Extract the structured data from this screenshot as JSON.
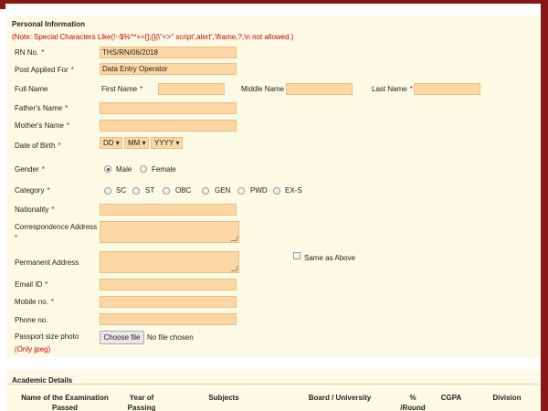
{
  "personal": {
    "title": "Personal Information",
    "note": "(Note: Special Characters Like(!~$%^*+=[];{}|\\\"<>\" script',alert','iframe,?,\\n not allowed.)",
    "rn_no": {
      "label": "RN No.",
      "value": "THS/RN/06/2018"
    },
    "post_applied": {
      "label": "Post Applied For",
      "value": "Data Entry Operator"
    },
    "full_name": {
      "label": "Full Name",
      "first_label": "First Name",
      "middle_label": "Middle Name",
      "last_label": "Last Name",
      "first": "",
      "middle": "",
      "last": ""
    },
    "father": {
      "label": "Father's Name",
      "value": ""
    },
    "mother": {
      "label": "Mother's Name",
      "value": ""
    },
    "dob": {
      "label": "Date of Birth",
      "dd": "DD",
      "mm": "MM",
      "yyyy": "YYYY"
    },
    "gender": {
      "label": "Gender",
      "options": [
        "Male",
        "Female"
      ],
      "selected": "Male"
    },
    "category": {
      "label": "Category",
      "options": [
        "SC",
        "ST",
        "OBC",
        "GEN",
        "PWD",
        "EX-S"
      ]
    },
    "nationality": {
      "label": "Nationality",
      "value": ""
    },
    "corr_address": {
      "label": "Correspondence Address"
    },
    "perm_address": {
      "label": "Permanent Address",
      "same_label": "Same as Above"
    },
    "email": {
      "label": "Email ID",
      "value": ""
    },
    "mobile": {
      "label": "Mobile no.",
      "value": ""
    },
    "phone": {
      "label": "Phone no.",
      "value": ""
    },
    "photo": {
      "label": "Passport size photo",
      "hint": "(Only jpeg)",
      "button": "Choose file",
      "status": "No file chosen"
    },
    "required_mark": "*"
  },
  "academic": {
    "title": "Academic Details",
    "columns": [
      [
        "Name of the Examination",
        "Passed"
      ],
      [
        "Year of",
        "Passing"
      ],
      [
        "Subjects"
      ],
      [
        "Board / University"
      ],
      [
        "%",
        "/Round"
      ],
      [
        "CGPA"
      ],
      [
        "Division"
      ]
    ]
  },
  "colors": {
    "accent_border": "#8a1717",
    "panel_bg": "#fcfae4",
    "input_bg": "#fcd7a4",
    "required": "#cc0000"
  }
}
